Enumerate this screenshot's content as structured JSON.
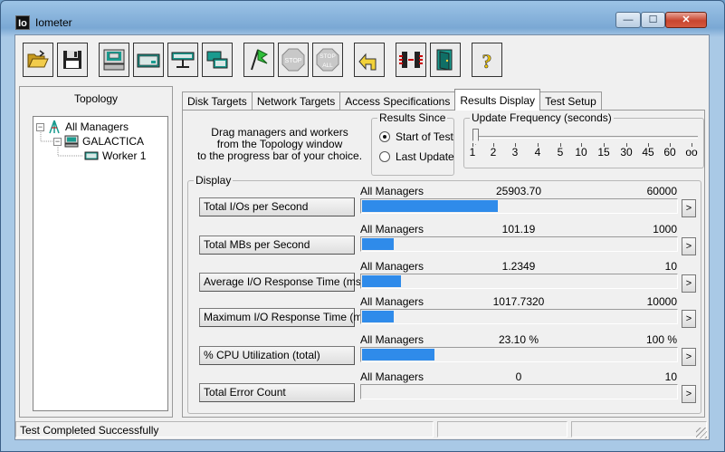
{
  "window": {
    "logo": "Io",
    "title": "Iometer",
    "minimize": "—",
    "maximize": "☐",
    "close": "✕"
  },
  "toolbar": {
    "buttons": [
      {
        "name": "open-config-button",
        "icon": "folder-open-icon"
      },
      {
        "name": "save-config-button",
        "icon": "floppy-disk-icon"
      },
      {
        "name": "start-new-manager-button",
        "icon": "computer-icon"
      },
      {
        "name": "start-disk-worker-button",
        "icon": "disk-worker-icon"
      },
      {
        "name": "start-network-worker-button",
        "icon": "network-worker-icon"
      },
      {
        "name": "duplicate-worker-button",
        "icon": "duplicate-worker-icon"
      },
      {
        "name": "start-tests-button",
        "icon": "green-flag-icon"
      },
      {
        "name": "stop-current-test-button",
        "icon": "stop-sign-icon",
        "label": "STOP"
      },
      {
        "name": "stop-all-button",
        "icon": "stop-all-sign-icon",
        "label_top": "STOP",
        "label_bottom": "ALL"
      },
      {
        "name": "reset-workers-button",
        "icon": "reset-arrow-icon"
      },
      {
        "name": "disconnect-button",
        "icon": "disconnect-icon"
      },
      {
        "name": "exit-button",
        "icon": "exit-door-icon"
      },
      {
        "name": "about-button",
        "icon": "question-mark-icon",
        "label": "?"
      }
    ]
  },
  "topology": {
    "title": "Topology",
    "tree": [
      {
        "label": "All Managers",
        "level": 0,
        "expander": "−"
      },
      {
        "label": "GALACTICA",
        "level": 1,
        "expander": "−"
      },
      {
        "label": "Worker 1",
        "level": 2
      }
    ]
  },
  "tabs": [
    {
      "label": "Disk Targets",
      "active": false
    },
    {
      "label": "Network Targets",
      "active": false
    },
    {
      "label": "Access Specifications",
      "active": false
    },
    {
      "label": "Results Display",
      "active": true
    },
    {
      "label": "Test Setup",
      "active": false
    }
  ],
  "results": {
    "drag_text": [
      "Drag managers and workers",
      "from the Topology window",
      "to the progress bar of your choice."
    ],
    "results_since": {
      "title": "Results Since",
      "options": [
        {
          "label": "Start of Test",
          "checked": true
        },
        {
          "label": "Last Update",
          "checked": false
        }
      ]
    },
    "update_frequency": {
      "title": "Update Frequency (seconds)",
      "ticks": [
        "1",
        "2",
        "3",
        "4",
        "5",
        "10",
        "15",
        "30",
        "45",
        "60",
        "oo"
      ],
      "selected": "1"
    },
    "display_title": "Display",
    "metrics": [
      {
        "button": "Total I/Os per Second",
        "source": "All Managers",
        "value": "25903.70",
        "max": "60000",
        "fill": 0.4317
      },
      {
        "button": "Total MBs per Second",
        "source": "All Managers",
        "value": "101.19",
        "max": "1000",
        "fill": 0.1012
      },
      {
        "button": "Average I/O Response Time (ms)",
        "source": "All Managers",
        "value": "1.2349",
        "max": "10",
        "fill": 0.1235
      },
      {
        "button": "Maximum I/O Response Time (ms)",
        "source": "All Managers",
        "value": "1017.7320",
        "max": "10000",
        "fill": 0.1018
      },
      {
        "button": "% CPU Utilization (total)",
        "source": "All Managers",
        "value": "23.10 %",
        "max": "100 %",
        "fill": 0.231
      },
      {
        "button": "Total Error Count",
        "source": "All Managers",
        "value": "0",
        "max": "10",
        "fill": 0
      }
    ],
    "arrow": ">"
  },
  "status": {
    "message": "Test Completed Successfully"
  },
  "colors": {
    "bar_fill": "#2f8bea"
  }
}
